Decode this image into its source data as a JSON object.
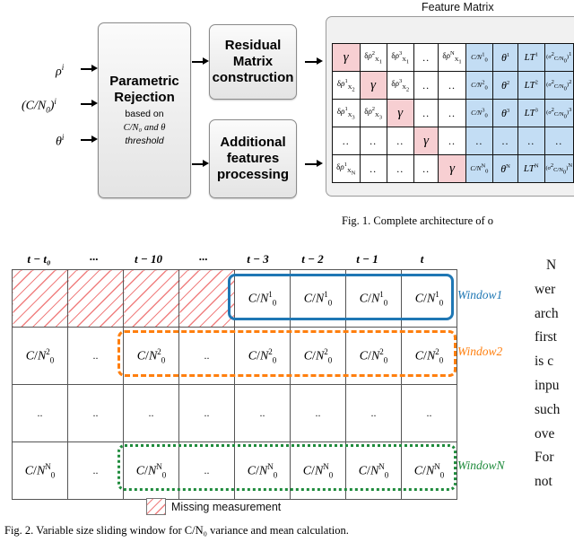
{
  "figure1": {
    "feature_matrix_title": "Feature Matrix",
    "caption": "Fig. 1.   Complete architecture of o",
    "inputs": [
      {
        "id": "rho",
        "label": "ρⁱ"
      },
      {
        "id": "cn0",
        "label": "(C/N₀)ⁱ"
      },
      {
        "id": "theta",
        "label": "θⁱ"
      }
    ],
    "boxes": {
      "parametric": {
        "title_line1": "Parametric",
        "title_line2": "Rejection",
        "sub1": "based on",
        "sub2": "C/N₀ and θ",
        "sub3": "threshold"
      },
      "residual": {
        "line1": "Residual",
        "line2": "Matrix",
        "line3": "construction"
      },
      "additional": {
        "line1": "Additional",
        "line2": "features",
        "line3": "processing"
      }
    },
    "matrix_rows": [
      [
        "γ",
        "δρ²_X₁",
        "δρ³_X₁",
        "..",
        "δρᴺ_X₁",
        "C/N₀¹",
        "θ¹",
        "LT¹",
        "(σ²_C/N₀)¹"
      ],
      [
        "δρ¹_X₂",
        "γ",
        "δρ³_X₂",
        "..",
        "..",
        "C/N₀²",
        "θ²",
        "LT²",
        "(σ²_C/N₀)²"
      ],
      [
        "δρ¹_X₃",
        "δρ²_X₃",
        "γ",
        "..",
        "..",
        "C/N₀³",
        "θ³",
        "LT³",
        "(σ²_C/N₀)³"
      ],
      [
        "..",
        "..",
        "..",
        "γ",
        "..",
        "..",
        "..",
        "..",
        ".."
      ],
      [
        "δρ¹_Xᴺ",
        "..",
        "..",
        "..",
        "γ",
        "C/N₀ᴺ",
        "θᴺ",
        "LTᴺ",
        "(σ²_C/N₀)ᴺ"
      ]
    ],
    "colors": {
      "diagonal_cell": "#f7cfd2",
      "extra_feature_cell": "#c3ddf4",
      "box_fill": "#f0f0f0"
    }
  },
  "figure2": {
    "caption": "Fig. 2.   Variable size sliding window for C/N₀ variance and mean calculation.",
    "column_headers": [
      "t − t₀",
      "···",
      "t − 10",
      "···",
      "t − 3",
      "t − 2",
      "t − 1",
      "t"
    ],
    "rows": [
      {
        "id": "row1",
        "cells": [
          "",
          "",
          "",
          "",
          "C/N₀¹",
          "C/N₀¹",
          "C/N₀¹",
          "C/N₀¹"
        ],
        "hatched": [
          true,
          true,
          true,
          true,
          false,
          false,
          false,
          false
        ]
      },
      {
        "id": "row2",
        "cells": [
          "C/N₀²",
          "..",
          "C/N₀²",
          "..",
          "C/N₀²",
          "C/N₀²",
          "C/N₀²",
          "C/N₀²"
        ],
        "hatched": [
          false,
          false,
          false,
          false,
          false,
          false,
          false,
          false
        ]
      },
      {
        "id": "row3",
        "cells": [
          "..",
          "..",
          "..",
          "..",
          "..",
          "..",
          "..",
          ".."
        ],
        "hatched": [
          false,
          false,
          false,
          false,
          false,
          false,
          false,
          false
        ]
      },
      {
        "id": "rowN",
        "cells": [
          "C/N₀ᴺ",
          "..",
          "C/N₀ᴺ",
          "..",
          "C/N₀ᴺ",
          "C/N₀ᴺ",
          "C/N₀ᴺ",
          "C/N₀ᴺ"
        ],
        "hatched": [
          false,
          false,
          false,
          false,
          false,
          false,
          false,
          false
        ]
      }
    ],
    "windows": [
      {
        "id": "window1",
        "label": "Window1",
        "color": "#1f77b4",
        "style": "solid"
      },
      {
        "id": "window2",
        "label": "Window2",
        "color": "#ff7f0e",
        "style": "dashed"
      },
      {
        "id": "windowN",
        "label": "WindowN",
        "color": "#1f8b3c",
        "style": "dotted"
      }
    ],
    "legend": {
      "label": "Missing measurement",
      "hatch_color": "#f08080"
    }
  },
  "body_text_fragment": {
    "lines": [
      "N",
      "wer",
      "arch",
      "first",
      "is c",
      "inpu",
      "such",
      "ove",
      "For",
      "not"
    ]
  }
}
